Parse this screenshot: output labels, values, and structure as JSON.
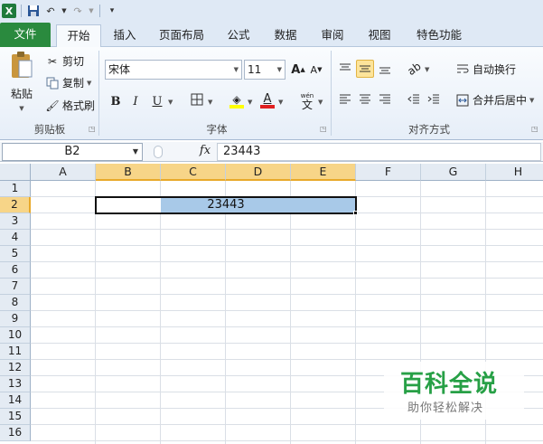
{
  "tabs": {
    "file": "文件",
    "home": "开始",
    "insert": "插入",
    "page_layout": "页面布局",
    "formulas": "公式",
    "data": "数据",
    "review": "审阅",
    "view": "视图",
    "features": "特色功能"
  },
  "ribbon": {
    "clipboard": {
      "paste": "粘贴",
      "cut": "剪切",
      "copy": "复制",
      "format_painter": "格式刷",
      "label": "剪贴板"
    },
    "font": {
      "name": "宋体",
      "size": "11",
      "label": "字体",
      "bold": "B",
      "italic": "I",
      "underline": "U",
      "grow": "A",
      "shrink": "A",
      "phonetic": "wén",
      "phonetic_char": "文"
    },
    "alignment": {
      "wrap_text": "自动换行",
      "merge_center": "合并后居中",
      "label": "对齐方式"
    }
  },
  "formula_bar": {
    "name_box": "B2",
    "fx": "fx",
    "value": "23443"
  },
  "sheet": {
    "columns": [
      "A",
      "B",
      "C",
      "D",
      "E",
      "F",
      "G",
      "H"
    ],
    "rows": [
      "1",
      "2",
      "3",
      "4",
      "5",
      "6",
      "7",
      "8",
      "9",
      "10",
      "11",
      "12",
      "13",
      "14",
      "15",
      "16"
    ],
    "merged_value": "23443"
  },
  "watermark": {
    "title": "百科全说",
    "subtitle": "助你轻松解决"
  },
  "colors": {
    "file_tab": "#2a8a3e",
    "selection": "#a8c9e8",
    "header_highlight": "#f7d588"
  }
}
